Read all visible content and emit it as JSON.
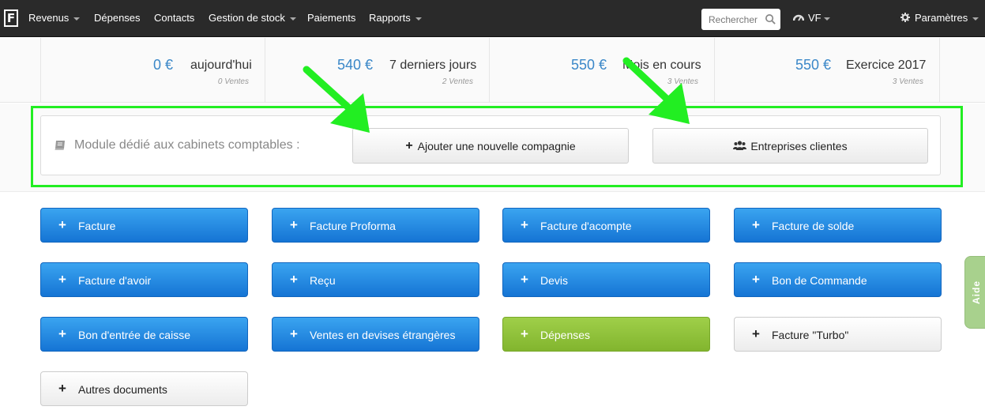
{
  "navbar": {
    "logo": "F",
    "items": [
      {
        "label": "Revenus",
        "dropdown": true
      },
      {
        "label": "Dépenses",
        "dropdown": false
      },
      {
        "label": "Contacts",
        "dropdown": false
      },
      {
        "label": "Gestion de stock",
        "dropdown": true
      },
      {
        "label": "Paiements",
        "dropdown": false
      },
      {
        "label": "Rapports",
        "dropdown": true
      }
    ],
    "search_placeholder": "Rechercher",
    "user_label": "VF",
    "settings_label": "Paramètres"
  },
  "stats": [
    {
      "amount": "0 €",
      "label": "aujourd'hui",
      "sub": "0 Ventes"
    },
    {
      "amount": "540 €",
      "label": "7 derniers jours",
      "sub": "2 Ventes"
    },
    {
      "amount": "550 €",
      "label": "Mois en cours",
      "sub": "3 Ventes"
    },
    {
      "amount": "550 €",
      "label": "Exercice 2017",
      "sub": "3 Ventes"
    }
  ],
  "module": {
    "title": "Module dédié aux cabinets comptables :",
    "add_company_label": "Ajouter une nouvelle compagnie",
    "client_companies_label": "Entreprises clientes"
  },
  "actions": [
    {
      "label": "Facture",
      "style": "blue"
    },
    {
      "label": "Facture Proforma",
      "style": "blue"
    },
    {
      "label": "Facture d'acompte",
      "style": "blue"
    },
    {
      "label": "Facture de solde",
      "style": "blue"
    },
    {
      "label": "Facture d'avoir",
      "style": "blue"
    },
    {
      "label": "Reçu",
      "style": "blue"
    },
    {
      "label": "Devis",
      "style": "blue"
    },
    {
      "label": "Bon de Commande",
      "style": "blue"
    },
    {
      "label": "Bon d'entrée de caisse",
      "style": "blue"
    },
    {
      "label": "Ventes en devises étrangères",
      "style": "blue"
    },
    {
      "label": "Dépenses",
      "style": "green"
    },
    {
      "label": "Facture \"Turbo\"",
      "style": "white"
    },
    {
      "label": "Autres documents",
      "style": "white"
    }
  ],
  "help_tab": "Aide",
  "colors": {
    "navbar": "#2a2a2a",
    "amount": "#3a87c8",
    "primary_button": "#1e88e5",
    "expense_button": "#8cc13a",
    "highlight": "#22ee22",
    "help_tab": "#a8d18d"
  },
  "icons": {
    "search": "magnifier-icon",
    "user": "dashboard-icon",
    "settings": "gear-icon",
    "module": "book-icon",
    "add": "plus-icon",
    "clients": "users-icon"
  }
}
